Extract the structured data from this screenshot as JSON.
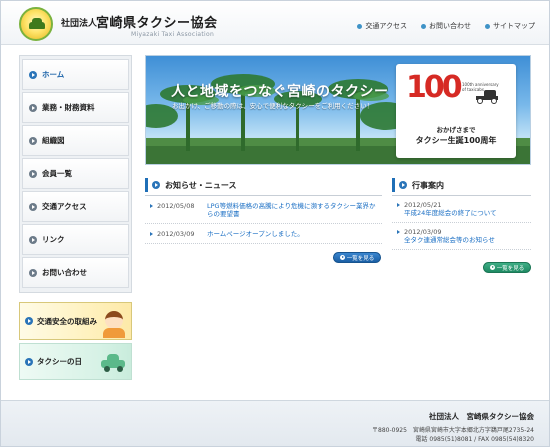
{
  "header": {
    "org_prefix": "社団法人",
    "org_name": "宮崎県タクシー協会",
    "org_en": "Miyazaki Taxi Association",
    "nav": [
      {
        "label": "交通アクセス"
      },
      {
        "label": "お問い合わせ"
      },
      {
        "label": "サイトマップ"
      }
    ]
  },
  "sidenav": {
    "items": [
      {
        "label": "ホーム"
      },
      {
        "label": "業務・財務資料"
      },
      {
        "label": "組織図"
      },
      {
        "label": "会員一覧"
      },
      {
        "label": "交通アクセス"
      },
      {
        "label": "リンク"
      },
      {
        "label": "お問い合わせ"
      }
    ]
  },
  "banners": {
    "safety": "交通安全の取組み",
    "taxi_day": "タクシーの日"
  },
  "hero": {
    "title": "人と地域をつなぐ宮崎のタクシー",
    "subtitle": "お出かけ、ご移動の際は、安心で便利なタクシーをご利用ください！",
    "emblem_number": "100",
    "emblem_small": "100th anniversary of taxicabs",
    "emblem_line1": "おかげさまで",
    "emblem_line2": "タクシー生誕100周年"
  },
  "news": {
    "heading": "お知らせ・ニュース",
    "items": [
      {
        "date": "2012/05/08",
        "text": "LPG等燃料価格の高騰により危機に瀕するタクシー業界からの要望書"
      },
      {
        "date": "2012/03/09",
        "text": "ホームページオープンしました。"
      }
    ],
    "more": "一覧を見る"
  },
  "events": {
    "heading": "行事案内",
    "items": [
      {
        "date": "2012/05/21",
        "text": "平成24年度総会の終了について"
      },
      {
        "date": "2012/03/09",
        "text": "全タク連通常総会等のお知らせ"
      }
    ],
    "more": "一覧を見る"
  },
  "footer": {
    "name": "社団法人　宮崎県タクシー協会",
    "address": "〒880-0925　宮崎県宮崎市大字本郷北方字鵜戸尾2735-24",
    "tel": "電話 0985(51)8081 / FAX 0985(54)8320"
  },
  "colors": {
    "accent": "#1f6fb7",
    "link": "#1b6fc4",
    "event_button": "#1e8a63"
  }
}
